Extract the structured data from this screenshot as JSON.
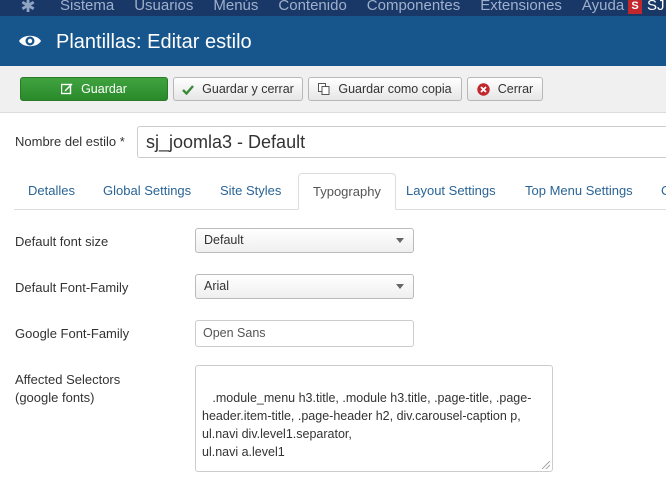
{
  "topnav": {
    "items": [
      "Sistema",
      "Usuarios",
      "Menús",
      "Contenido",
      "Componentes",
      "Extensiones",
      "Ayuda"
    ],
    "site_label": "SJ"
  },
  "header": {
    "title": "Plantillas: Editar estilo"
  },
  "toolbar": {
    "save_label": "Guardar",
    "save_close_label": "Guardar y cerrar",
    "save_copy_label": "Guardar como copia",
    "close_label": "Cerrar"
  },
  "style_name": {
    "label": "Nombre del estilo *",
    "value": "sj_joomla3 - Default"
  },
  "tabs": [
    {
      "label": "Detalles"
    },
    {
      "label": "Global Settings"
    },
    {
      "label": "Site Styles"
    },
    {
      "label": "Typography"
    },
    {
      "label": "Layout Settings"
    },
    {
      "label": "Top Menu Settings"
    },
    {
      "label": "C"
    }
  ],
  "fields": {
    "font_size": {
      "label": "Default font size",
      "value": "Default"
    },
    "font_family": {
      "label": "Default Font-Family",
      "value": "Arial"
    },
    "google_font": {
      "label": "Google Font-Family",
      "value": "Open Sans"
    },
    "selectors": {
      "label_line1": "Affected Selectors",
      "label_line2": "(google fonts)",
      "value": " .module_menu h3.title, .module h3.title, .page-title, .page-header.item-title, .page-header h2, div.carousel-caption p,\nul.navi div.level1.separator,\nul.navi a.level1"
    }
  },
  "colors": {
    "topnav_bg": "#1a3867",
    "header_bg": "#17568c",
    "save_green": "#2f9a2f",
    "link_blue": "#2a6496",
    "close_red": "#c0282d"
  }
}
